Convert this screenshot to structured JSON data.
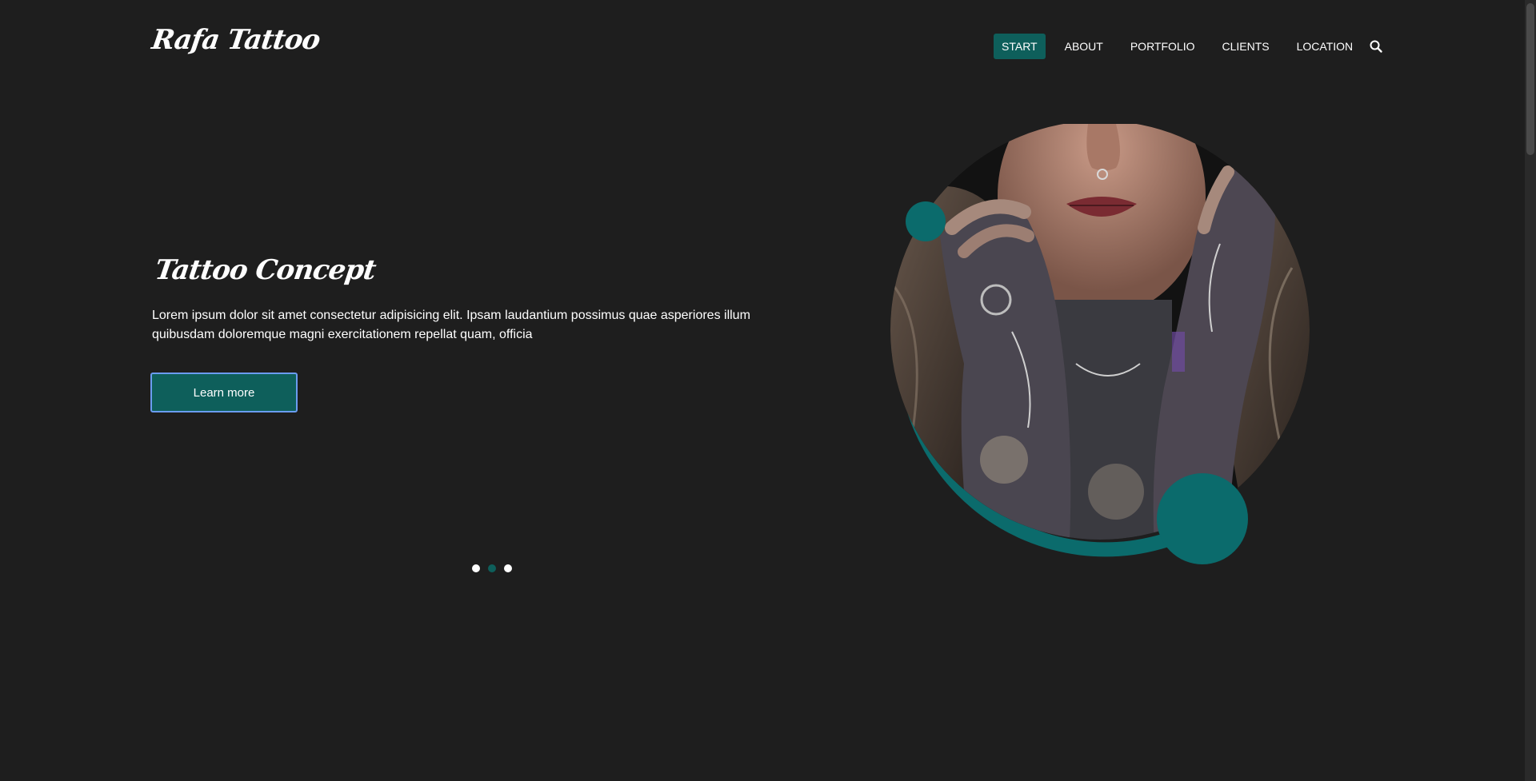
{
  "header": {
    "logo": "Rafa Tattoo",
    "nav": [
      {
        "label": "START",
        "active": true
      },
      {
        "label": "ABOUT",
        "active": false
      },
      {
        "label": "PORTFOLIO",
        "active": false
      },
      {
        "label": "CLIENTS",
        "active": false
      },
      {
        "label": "LOCATION",
        "active": false
      }
    ],
    "search_icon": "search-icon"
  },
  "hero": {
    "title": "Tattoo Concept",
    "text": "Lorem ipsum dolor sit amet consectetur adipisicing elit. Ipsam laudantium possimus quae asperiores illum quibusdam doloremque magni exercitationem repellat quam, officia",
    "button_label": "Learn more",
    "slider_dots": 3,
    "active_dot": 2,
    "image_icon": "tattooed-woman-portrait"
  },
  "colors": {
    "background": "#1e1e1e",
    "accent": "#0e5f5b",
    "accent_ring": "#0b6b6c",
    "button_border": "#6b9cf0",
    "text": "#ffffff"
  }
}
